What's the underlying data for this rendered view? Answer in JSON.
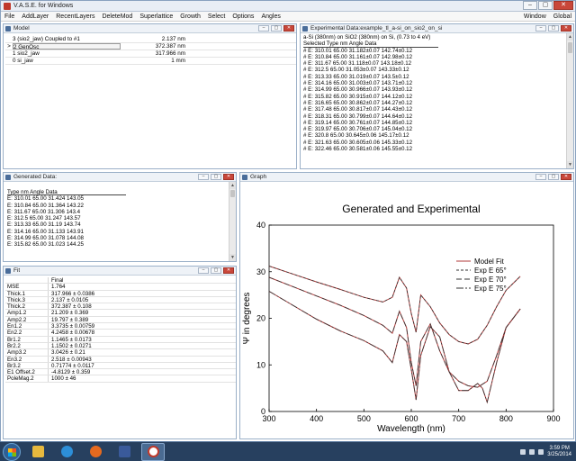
{
  "app": {
    "title": "V.A.S.E. for Windows"
  },
  "menu": {
    "items": [
      "File",
      "AddLayer",
      "RecentLayers",
      "DeleteMod",
      "Superlattice",
      "Growth",
      "Select",
      "Options",
      "Angles"
    ],
    "right": [
      "Window",
      "Global"
    ]
  },
  "model": {
    "title": "Model",
    "rows": [
      {
        "mark": "",
        "name": "3 (sio2_jaw) Coupled to #1",
        "value": "2.137 nm"
      },
      {
        "mark": ">",
        "name": "2 GenOsc",
        "value": "372.387 nm"
      },
      {
        "mark": "",
        "name": "1 sio2_jaw",
        "value": "317.966 nm"
      },
      {
        "mark": "",
        "name": "0 si_jaw",
        "value": "1 mm"
      }
    ]
  },
  "experimental": {
    "title": "Experimental Data:example_tl_a-si_on_sio2_on_si",
    "subtitle": "a-Si (380nm) on SiO2 (380nm) on Si, (0.73 to 4 eV)",
    "header": "Selected Type  nm  Angle  Data",
    "rows": [
      "# E: 310.01  65.00  31.182±0.07  142.74±0.12",
      "# E: 310.84  65.00  31.161±0.07  142.98±0.12",
      "# E: 311.67  65.00  31.118±0.07  143.18±0.12",
      "# E: 312.5  65.00  31.053±0.07  143.33±0.12",
      "# E: 313.33  65.00  31.019±0.07  143.5±0.12",
      "# E: 314.16  65.00  31.003±0.07  143.71±0.12",
      "# E: 314.99  65.00  30.966±0.07  143.93±0.12",
      "# E: 315.82  65.00  30.915±0.07  144.12±0.12",
      "# E: 316.65  65.00  30.862±0.07  144.27±0.12",
      "# E: 317.48  65.00  30.817±0.07  144.43±0.12",
      "# E: 318.31  65.00  30.799±0.07  144.64±0.12",
      "# E: 319.14  65.00  30.761±0.07  144.85±0.12",
      "# E: 319.97  65.00  30.706±0.07  145.04±0.12",
      "# E: 320.8  65.00  30.645±0.06  145.17±0.12",
      "# E: 321.63  65.00  30.605±0.06  145.33±0.12",
      "# E: 322.46  65.00  30.581±0.06  145.55±0.12"
    ]
  },
  "generated": {
    "title": "Generated Data:",
    "header": "Type  nm  Angle  Data",
    "rows": [
      "E: 310.01  65.00  31.424  143.05",
      "E: 310.84  65.00  31.364  143.22",
      "E: 311.67  65.00  31.306  143.4",
      "E: 312.5  65.00  31.247  143.57",
      "E: 313.33  65.00  31.19  143.74",
      "E: 314.16  65.00  31.133  143.91",
      "E: 314.99  65.00  31.078  144.08",
      "E: 315.82  65.00  31.023  144.25"
    ]
  },
  "fit": {
    "title": "Fit",
    "col_header": "Final",
    "rows": [
      {
        "k": "MSE",
        "v": "1.764"
      },
      {
        "k": "Thick.1",
        "v": "317.966 ± 0.0386"
      },
      {
        "k": "Thick.3",
        "v": "2.137 ± 0.0105"
      },
      {
        "k": "Thick.2",
        "v": "372.387 ± 0.108"
      },
      {
        "k": "Amp1.2",
        "v": "21.209 ± 0.369"
      },
      {
        "k": "Amp2.2",
        "v": "19.797 ± 0.389"
      },
      {
        "k": "En1.2",
        "v": "3.3735 ± 0.00759"
      },
      {
        "k": "En2.2",
        "v": "4.2458 ± 0.00678"
      },
      {
        "k": "Br1.2",
        "v": "1.1465 ± 0.0173"
      },
      {
        "k": "Br2.2",
        "v": "1.1502 ± 0.0271"
      },
      {
        "k": "Amp3.2",
        "v": "3.0426 ± 0.21"
      },
      {
        "k": "En3.2",
        "v": "2.518 ± 0.00943"
      },
      {
        "k": "Br3.2",
        "v": "0.71774 ± 0.0117"
      },
      {
        "k": "E1 Offset.2",
        "v": "-4.8129 ± 0.359"
      },
      {
        "k": "PoleMag.2",
        "v": "1000 ± 46"
      }
    ]
  },
  "graph": {
    "title": "Graph"
  },
  "taskbar": {
    "time": "3:59 PM",
    "date": "3/25/2014"
  },
  "chart_data": {
    "type": "line",
    "title": "Generated and Experimental",
    "xlabel": "Wavelength (nm)",
    "ylabel": "Ψ in degrees",
    "xlim": [
      300,
      900
    ],
    "ylim": [
      0,
      40
    ],
    "xticks": [
      300,
      400,
      500,
      600,
      700,
      800,
      900
    ],
    "yticks": [
      0,
      10,
      20,
      30,
      40
    ],
    "legend_position": "top-right",
    "legend": [
      "Model Fit",
      "Exp E 65°",
      "Exp E 70°",
      "Exp E 75°"
    ],
    "colors": {
      "fit": "#b23a3a",
      "exp": "#333333"
    },
    "series": [
      {
        "name": "Exp E 65°",
        "x": [
          300,
          350,
          400,
          450,
          500,
          540,
          560,
          575,
          590,
          600,
          610,
          620,
          640,
          660,
          680,
          700,
          720,
          740,
          760,
          780,
          800,
          830
        ],
        "y": [
          31.2,
          29.5,
          27.8,
          26.2,
          24.5,
          23.5,
          24.5,
          28.8,
          26.5,
          21.0,
          17.0,
          25.0,
          22.5,
          19.0,
          16.5,
          15.0,
          14.5,
          15.5,
          18.5,
          22.5,
          26.0,
          29.0
        ]
      },
      {
        "name": "Exp E 70°",
        "x": [
          300,
          350,
          400,
          450,
          500,
          540,
          560,
          575,
          590,
          600,
          610,
          620,
          640,
          660,
          680,
          700,
          720,
          740,
          760,
          780,
          800,
          830
        ],
        "y": [
          28.8,
          26.8,
          24.8,
          22.8,
          20.6,
          18.5,
          16.8,
          21.5,
          18.0,
          10.5,
          5.5,
          15.0,
          18.8,
          13.0,
          8.5,
          6.5,
          5.5,
          5.2,
          6.5,
          12.0,
          18.0,
          22.0
        ]
      },
      {
        "name": "Exp E 75°",
        "x": [
          300,
          350,
          400,
          450,
          500,
          540,
          560,
          575,
          590,
          600,
          610,
          620,
          640,
          660,
          680,
          700,
          720,
          740,
          750,
          760,
          780,
          800,
          830
        ],
        "y": [
          25.8,
          22.8,
          19.8,
          17.3,
          15.2,
          13.0,
          10.5,
          16.5,
          15.0,
          9.0,
          2.5,
          12.0,
          18.2,
          16.0,
          8.5,
          4.5,
          4.5,
          6.0,
          5.0,
          2.0,
          10.5,
          18.0,
          22.0
        ]
      }
    ]
  }
}
